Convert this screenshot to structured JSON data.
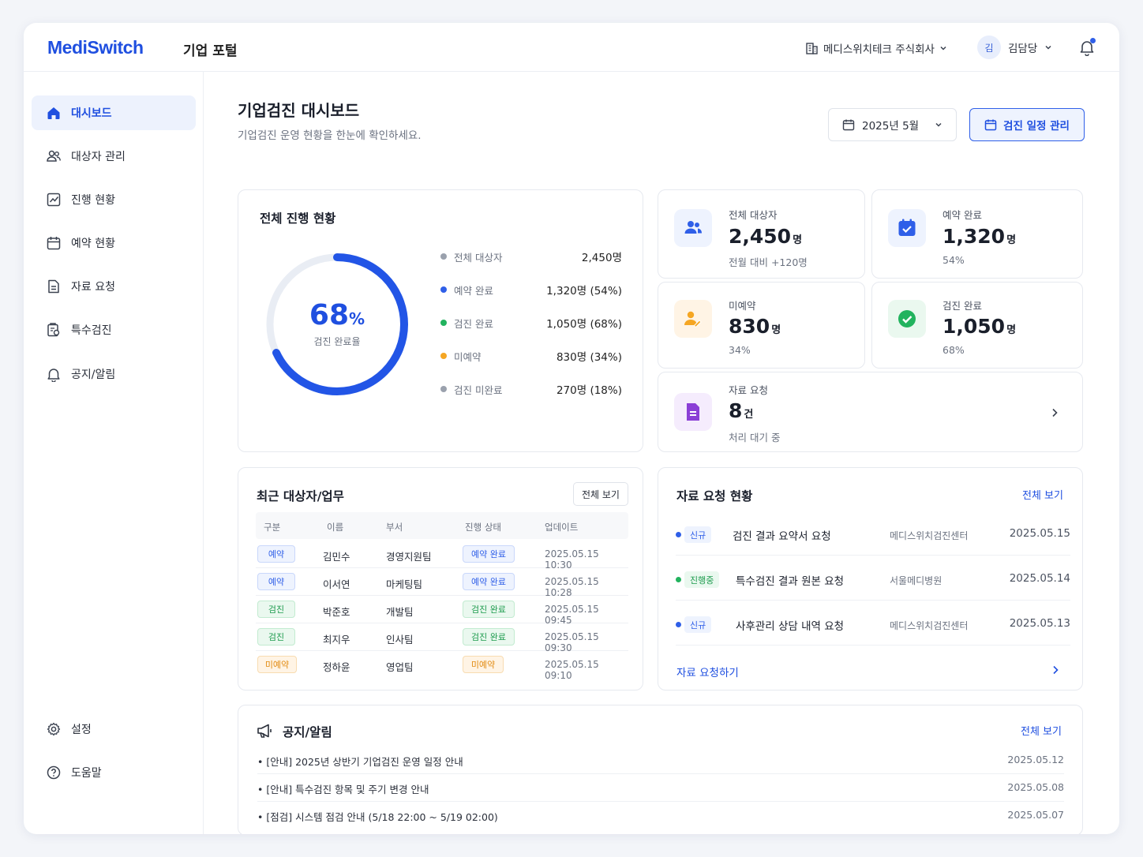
{
  "header": {
    "logo": "MediSwitch",
    "portal_title": "기업 포털",
    "company": "메디스위치테크 주식회사",
    "avatar_initial": "김",
    "user_name": "김담당"
  },
  "sidebar": {
    "items": [
      {
        "label": "대시보드",
        "icon": "home-icon",
        "active": true
      },
      {
        "label": "대상자 관리",
        "icon": "users-icon"
      },
      {
        "label": "진행 현황",
        "icon": "chart-icon"
      },
      {
        "label": "예약 현황",
        "icon": "calendar-icon"
      },
      {
        "label": "자료 요청",
        "icon": "document-icon"
      },
      {
        "label": "특수검진",
        "icon": "clipboard-icon"
      },
      {
        "label": "공지/알림",
        "icon": "bell-icon"
      }
    ],
    "bottom": [
      {
        "label": "설정",
        "icon": "gear-icon"
      },
      {
        "label": "도움말",
        "icon": "help-icon"
      }
    ]
  },
  "page": {
    "title": "기업검진 대시보드",
    "subtitle": "기업검진 운영 현황을 한눈에 확인하세요.",
    "month": "2025년 5월",
    "schedule_button": "검진 일정 관리"
  },
  "progress": {
    "title": "전체 진행 현황",
    "percent": 68,
    "percent_number": "68",
    "percent_unit": "%",
    "percent_label": "검진 완료율",
    "legend": [
      {
        "label": "전체 대상자",
        "value": "2,450명",
        "color": "#9aa1ad"
      },
      {
        "label": "예약 완료",
        "value": "1,320명 (54%)",
        "color": "#2f5fe8"
      },
      {
        "label": "검진 완료",
        "value": "1,050명 (68%)",
        "color": "#22b35e"
      },
      {
        "label": "미예약",
        "value": "830명 (34%)",
        "color": "#f5a623"
      },
      {
        "label": "검진 미완료",
        "value": "270명 (18%)",
        "color": "#9aa1ad"
      }
    ]
  },
  "stats": {
    "total": {
      "label": "전체 대상자",
      "value": "2,450",
      "unit": "명",
      "note": "전월 대비 +120명"
    },
    "reserved": {
      "label": "예약 완료",
      "value": "1,320",
      "unit": "명",
      "note": "54%"
    },
    "unreserved": {
      "label": "미예약",
      "value": "830",
      "unit": "명",
      "note": "34%"
    },
    "done": {
      "label": "검진 완료",
      "value": "1,050",
      "unit": "명",
      "note": "68%"
    },
    "requests": {
      "label": "자료 요청",
      "value": "8",
      "unit": "건",
      "note": "처리 대기 중"
    }
  },
  "recent": {
    "title": "최근 대상자/업무",
    "view_all": "전체 보기",
    "columns": [
      "구분",
      "이름",
      "부서",
      "진행 상태",
      "업데이트"
    ],
    "rows": [
      {
        "type": "예약",
        "name": "김민수",
        "dept": "경영지원팀",
        "status": "예약 완료",
        "updated": "2025.05.15 10:30",
        "tone": "blue"
      },
      {
        "type": "예약",
        "name": "이서연",
        "dept": "마케팅팀",
        "status": "예약 완료",
        "updated": "2025.05.15 10:28",
        "tone": "blue"
      },
      {
        "type": "검진",
        "name": "박준호",
        "dept": "개발팀",
        "status": "검진 완료",
        "updated": "2025.05.15 09:45",
        "tone": "green"
      },
      {
        "type": "검진",
        "name": "최지우",
        "dept": "인사팀",
        "status": "검진 완료",
        "updated": "2025.05.15 09:30",
        "tone": "green"
      },
      {
        "type": "미예약",
        "name": "정하윤",
        "dept": "영업팀",
        "status": "미예약",
        "updated": "2025.05.15 09:10",
        "tone": "orange"
      }
    ]
  },
  "requests": {
    "title": "자료 요청 현황",
    "view_all": "전체 보기",
    "items": [
      {
        "tag": "신규",
        "title": "검진 결과 요약서 요청",
        "org": "메디스위치검진센터",
        "date": "2025.05.15",
        "tone": "blue"
      },
      {
        "tag": "진행중",
        "title": "특수검진 결과 원본 요청",
        "org": "서울메디병원",
        "date": "2025.05.14",
        "tone": "green"
      },
      {
        "tag": "신규",
        "title": "사후관리 상담 내역 요청",
        "org": "메디스위치검진센터",
        "date": "2025.05.13",
        "tone": "blue"
      }
    ],
    "action": "자료 요청하기"
  },
  "notices": {
    "title": "공지/알림",
    "view_all": "전체 보기",
    "items": [
      {
        "text": "• [안내] 2025년 상반기 기업검진 운영 일정 안내",
        "date": "2025.05.12"
      },
      {
        "text": "• [안내] 특수검진 항목 및 주기 변경 안내",
        "date": "2025.05.08"
      },
      {
        "text": "• [점검] 시스템 점검 안내 (5/18 22:00 ~ 5/19 02:00)",
        "date": "2025.05.07"
      }
    ]
  },
  "colors": {
    "accent": "#1f4fe0",
    "green": "#22b35e",
    "orange": "#f5a623",
    "purple": "#8b3fd6"
  }
}
